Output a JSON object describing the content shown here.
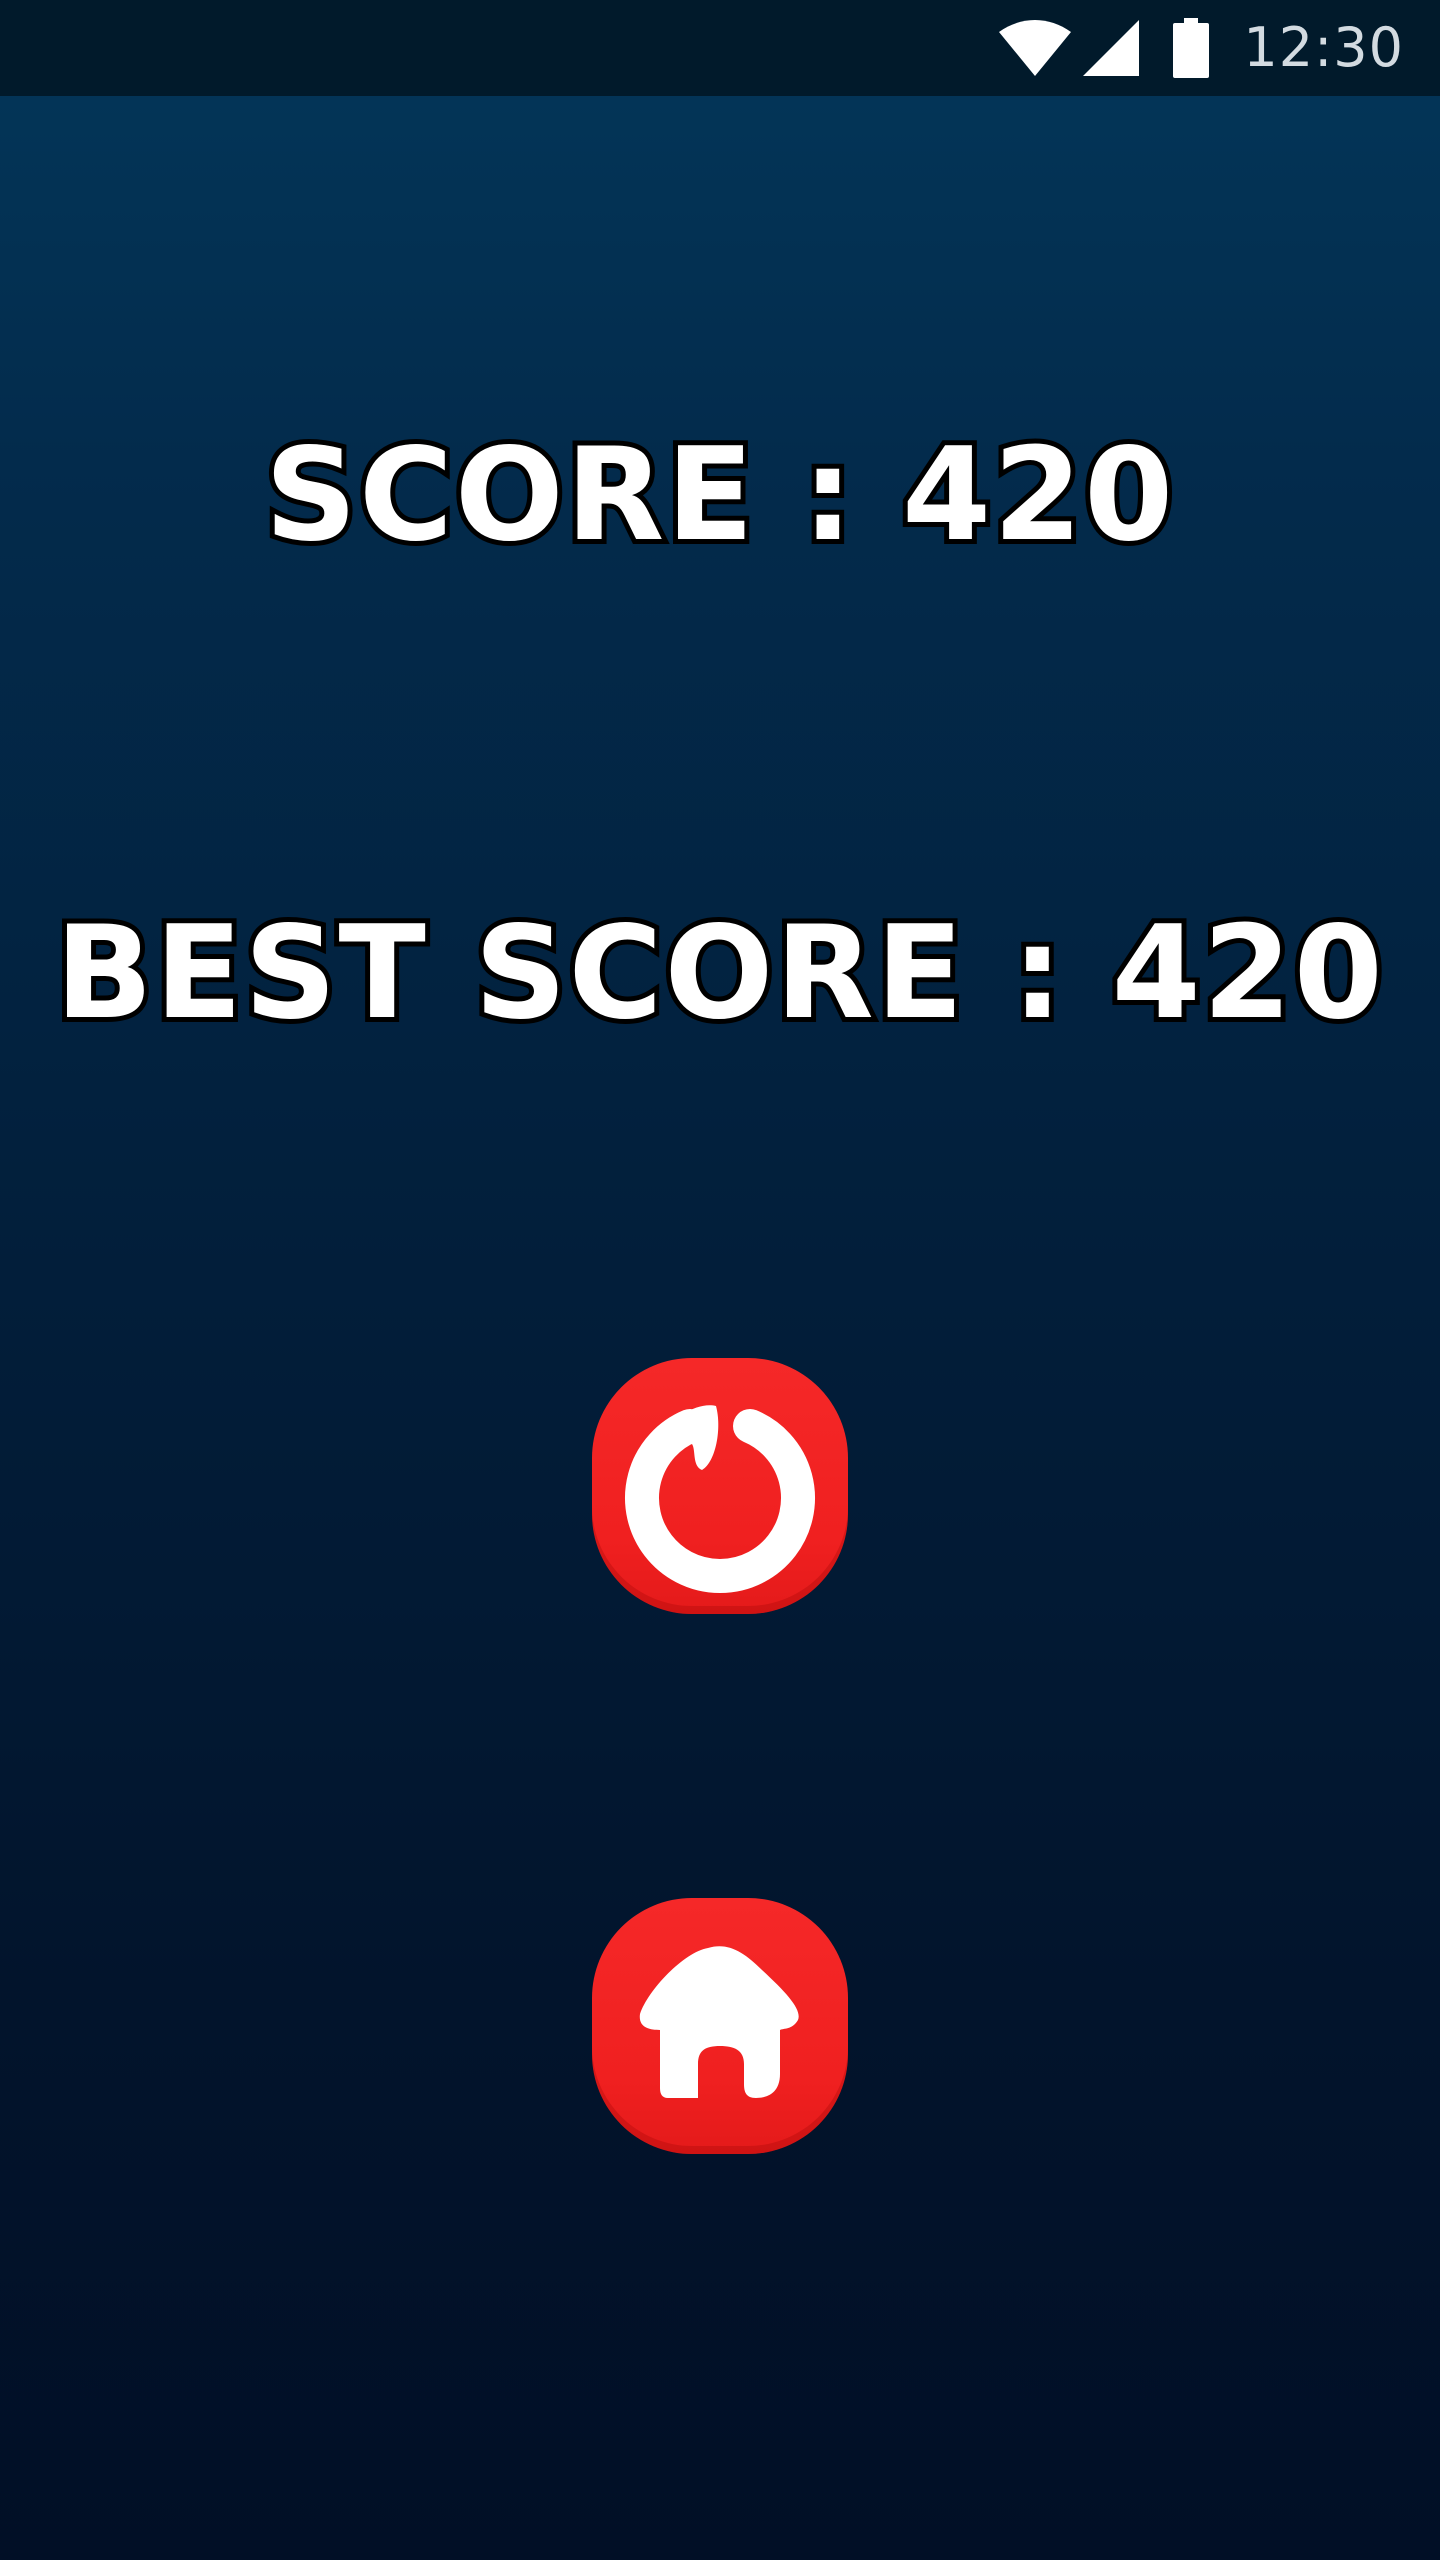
{
  "status_bar": {
    "time": "12:30",
    "icons": [
      "wifi-icon",
      "cell-signal-icon",
      "battery-icon"
    ]
  },
  "score": {
    "current_text": "SCORE : 420",
    "best_text": "BEST SCORE : 420",
    "current_value": 420,
    "best_value": 420
  },
  "buttons": {
    "replay_icon": "replay-icon",
    "home_icon": "home-icon"
  },
  "colors": {
    "button_red": "#f02020",
    "background_top": "#03375a",
    "background_bottom": "#010f26",
    "text_fill": "#ffffff",
    "text_outline": "#000000"
  }
}
